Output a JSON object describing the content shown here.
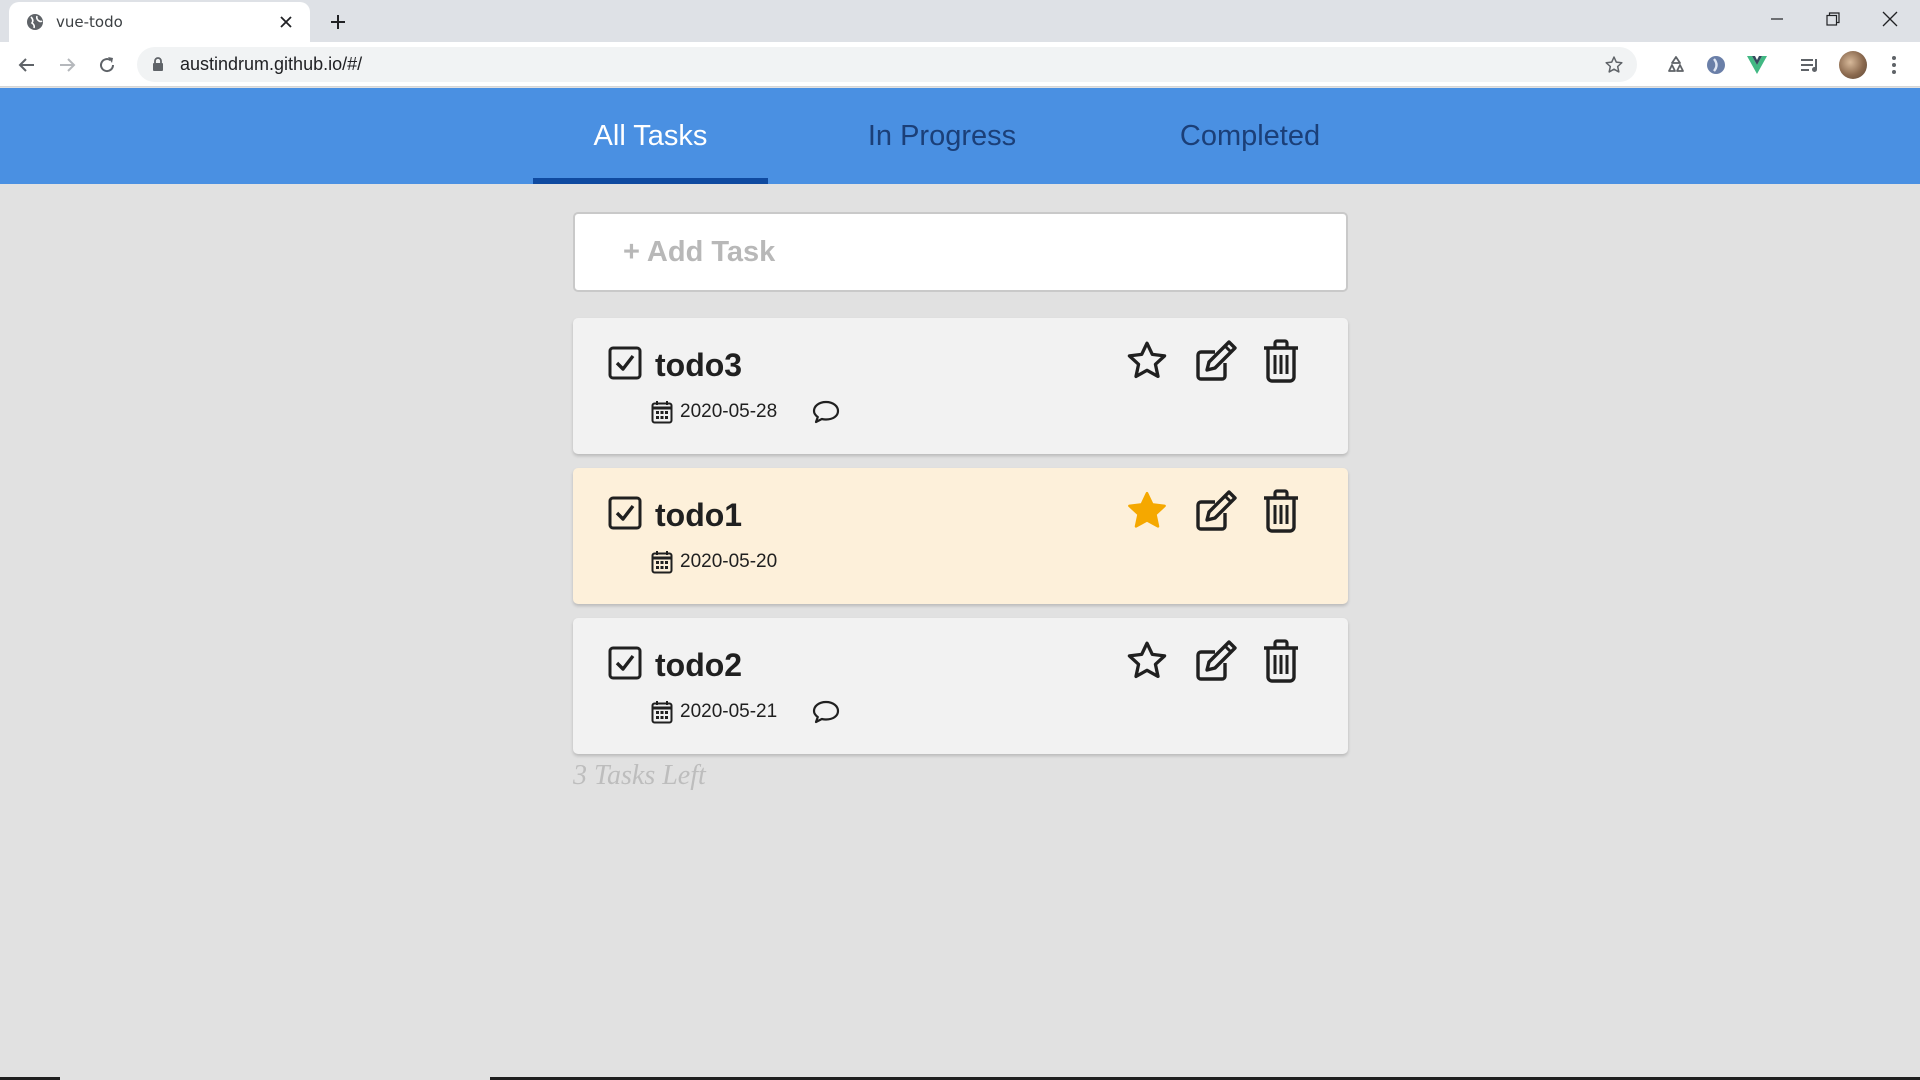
{
  "browser": {
    "tab_title": "vue-todo",
    "url": "austindrum.github.io/#/"
  },
  "nav": {
    "tabs": [
      {
        "label": "All Tasks",
        "active": true
      },
      {
        "label": "In Progress",
        "active": false
      },
      {
        "label": "Completed",
        "active": false
      }
    ]
  },
  "add_task": {
    "placeholder": "+ Add Task"
  },
  "tasks": [
    {
      "name": "todo3",
      "date": "2020-05-28",
      "starred": false,
      "has_comment": true,
      "completed": true
    },
    {
      "name": "todo1",
      "date": "2020-05-20",
      "starred": true,
      "has_comment": false,
      "completed": true
    },
    {
      "name": "todo2",
      "date": "2020-05-21",
      "starred": false,
      "has_comment": true,
      "completed": true
    }
  ],
  "footer": {
    "tasks_left": "3 Tasks Left"
  },
  "colors": {
    "header": "#4a90e2",
    "active_tab_text": "#ffffff",
    "inactive_tab_text": "#1b3f78",
    "tab_indicator": "#0f4aa0",
    "star_active": "#f5a800",
    "starred_background": "#fdf0da",
    "page_background": "#e1e1e1"
  },
  "icons": [
    "globe-icon",
    "close-icon",
    "plus-icon",
    "back-arrow-icon",
    "forward-arrow-icon",
    "reload-icon",
    "lock-icon",
    "bookmark-star-icon",
    "checkbox-icon",
    "calendar-icon",
    "comment-icon",
    "star-icon",
    "edit-icon",
    "trash-icon"
  ]
}
